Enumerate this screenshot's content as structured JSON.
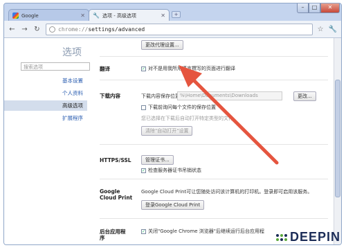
{
  "tabs": [
    {
      "label": "Google",
      "icon": "google-favicon"
    },
    {
      "label": "选项 - 高级选项",
      "icon": "wrench-icon"
    }
  ],
  "toolbar": {
    "url_scheme": "chrome://",
    "url_path": "settings/advanced"
  },
  "sidebar": {
    "title": "选项",
    "search_placeholder": "搜索选项",
    "items": [
      {
        "label": "基本设置"
      },
      {
        "label": "个人资料"
      },
      {
        "label": "高级选项"
      },
      {
        "label": "扩展程序"
      }
    ]
  },
  "main": {
    "proxy_button": "更改代理设置...",
    "translate": {
      "title": "翻译",
      "checkbox": "对不是用我所用语言撰写的页面进行翻译"
    },
    "downloads": {
      "title": "下载内容",
      "location_label": "下载内容保存位置:",
      "location_value": "%\\Home\\Documents\\Downloads",
      "change_button": "更改...",
      "ask_checkbox": "下载前询问每个文件的保存位置",
      "auto_open_text": "您已选择在下载后自动打开特定类型的文件。",
      "clear_button": "清除\"自动打开\"设置"
    },
    "https": {
      "title": "HTTPS/SSL",
      "manage_button": "管理证书...",
      "revocation_checkbox": "检查服务器证书吊销状态"
    },
    "cloud_print": {
      "title_line1": "Google",
      "title_line2": "Cloud Print",
      "description": "Google Cloud Print可让您随处访问该计算机的打印机。登录即可启用该服务。",
      "signin_button": "登录Google Cloud Print"
    },
    "background": {
      "title_line1": "后台应用程",
      "title_line2": "序",
      "checkbox": "关闭\"Google Chrome 浏览器\"后继续运行后台应用程"
    }
  },
  "watermark": "DEEPIN",
  "colors": {
    "accent": "#2a5db0",
    "arrow": "#e5553f",
    "selected_nav": "#d3ddec"
  }
}
